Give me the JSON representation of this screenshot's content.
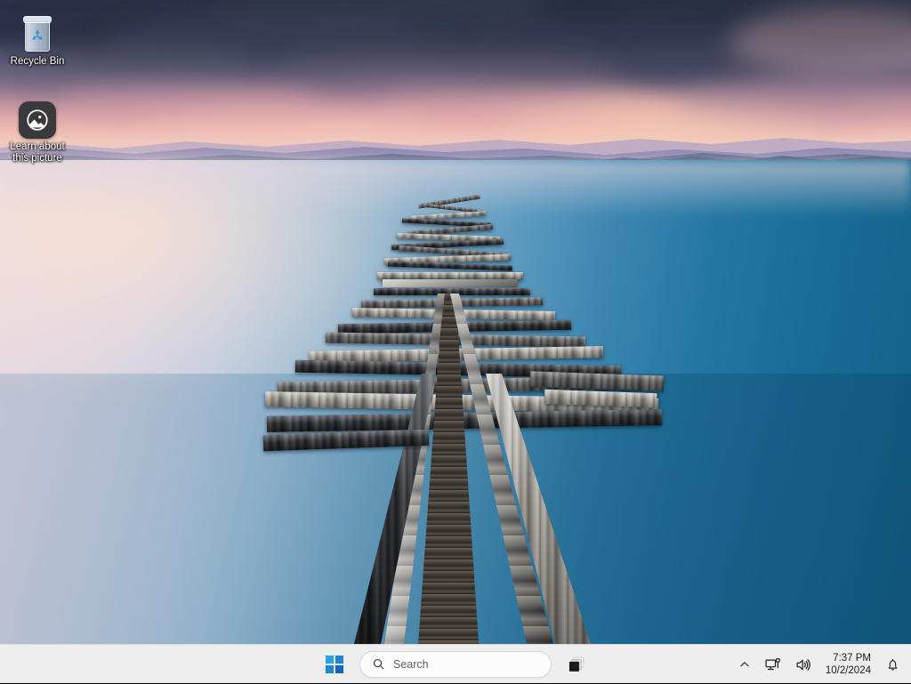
{
  "desktop": {
    "icons": [
      {
        "name": "recycle-bin",
        "label": "Recycle Bin",
        "icon": "recycle-bin-icon"
      },
      {
        "name": "learn-about-this-picture",
        "label": "Learn about\nthis picture",
        "icon": "picture-info-icon"
      }
    ],
    "wallpaper": {
      "description": "Wooden pier extending into a calm lake at sunset with mountains on the horizon",
      "sky_dark": "#3d4660",
      "sky_pink": "#eebbb2",
      "water_light": "#e8dbe0",
      "water_deep": "#135f86"
    }
  },
  "taskbar": {
    "background": "#eeeeee",
    "start": {
      "label": "Start",
      "icon": "windows-logo-icon",
      "color": "#0a84d8"
    },
    "search": {
      "placeholder": "Search",
      "value": "",
      "icon": "search-icon"
    },
    "task_view": {
      "label": "Task view",
      "icon": "task-view-icon"
    },
    "tray": {
      "overflow": {
        "label": "Show hidden icons",
        "icon": "chevron-up-icon"
      },
      "network": {
        "label": "Network",
        "icon": "network-icon"
      },
      "volume": {
        "label": "Volume",
        "icon": "speaker-icon"
      },
      "clock": {
        "time": "7:37 PM",
        "date": "10/2/2024"
      },
      "notifications": {
        "label": "Notifications",
        "icon": "bell-icon"
      }
    }
  }
}
